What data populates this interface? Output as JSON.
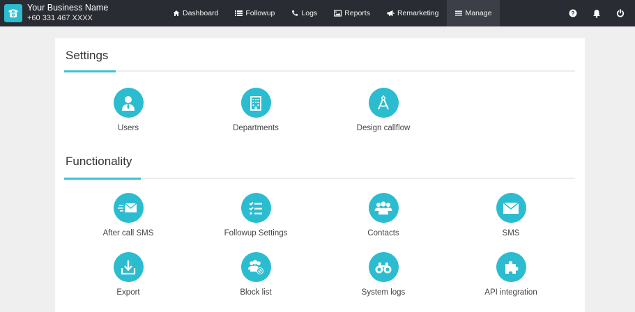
{
  "brand": {
    "name": "Your Business Name",
    "phone": "+60 331 467 XXXX",
    "logo_icon": "telephone-icon",
    "accent_color": "#2bbccf",
    "topbar_color": "#2a2c33"
  },
  "nav": {
    "items": [
      {
        "label": "Dashboard",
        "icon": "home-icon"
      },
      {
        "label": "Followup",
        "icon": "list-icon"
      },
      {
        "label": "Logs",
        "icon": "phone-icon"
      },
      {
        "label": "Reports",
        "icon": "image-icon"
      },
      {
        "label": "Remarketing",
        "icon": "bullhorn-icon"
      },
      {
        "label": "Manage",
        "icon": "bars-icon",
        "active": true
      }
    ]
  },
  "top_icons": [
    "help-icon",
    "bell-icon",
    "power-icon"
  ],
  "settings": {
    "title": "Settings",
    "tiles": [
      {
        "label": "Users",
        "icon": "user-icon"
      },
      {
        "label": "Departments",
        "icon": "building-icon"
      },
      {
        "label": "Design callflow",
        "icon": "compass-icon"
      }
    ]
  },
  "functionality": {
    "title": "Functionality",
    "tiles": [
      {
        "label": "After call SMS",
        "icon": "fast-mail-icon"
      },
      {
        "label": "Followup Settings",
        "icon": "checklist-icon"
      },
      {
        "label": "Contacts",
        "icon": "group-icon"
      },
      {
        "label": "SMS",
        "icon": "envelope-icon"
      },
      {
        "label": "Export",
        "icon": "download-icon"
      },
      {
        "label": "Block list",
        "icon": "block-users-icon"
      },
      {
        "label": "System logs",
        "icon": "binoculars-icon"
      },
      {
        "label": "API integration",
        "icon": "puzzle-icon"
      }
    ]
  }
}
